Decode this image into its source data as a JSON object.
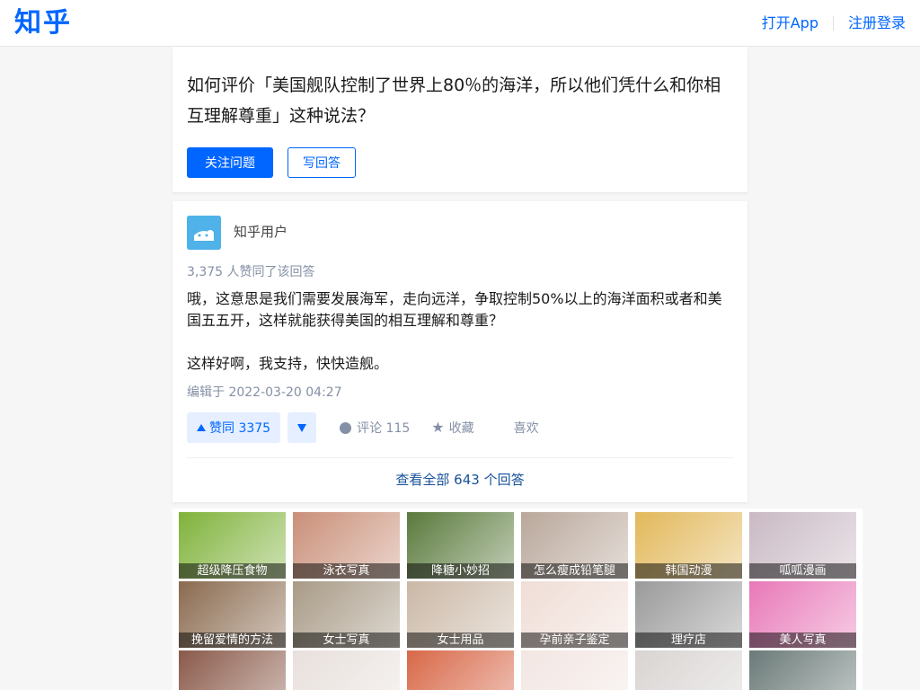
{
  "header": {
    "logo": "知乎",
    "open_app": "打开App",
    "register_login": "注册登录"
  },
  "question": {
    "title": "如何评价「美国舰队控制了世界上80％的海洋，所以他们凭什么和你相互理解尊重」这种说法？",
    "follow_label": "关注问题",
    "write_answer_label": "写回答"
  },
  "answer": {
    "author": "知乎用户",
    "votes_text": "3,375 人赞同了该回答",
    "paragraphs": [
      "哦，这意思是我们需要发展海军，走向远洋，争取控制50%以上的海洋面积或者和美国五五开，这样就能获得美国的相互理解和尊重？",
      "这样好啊，我支持，快快造舰。"
    ],
    "edited": "编辑于 2022-03-20 04:27",
    "vote_label": "赞同 3375",
    "comment_label": "评论 115",
    "collect_label": "收藏",
    "like_label": "喜欢",
    "view_all": "查看全部 643 个回答"
  },
  "ads": [
    {
      "caption": "超级降压食物",
      "color": "#7fb23a"
    },
    {
      "caption": "泳衣写真",
      "color": "#c98f78"
    },
    {
      "caption": "降糖小妙招",
      "color": "#5a7a3c"
    },
    {
      "caption": "怎么瘦成铅笔腿",
      "color": "#b9a79a"
    },
    {
      "caption": "韩国动漫",
      "color": "#e2b85a"
    },
    {
      "caption": "呱呱漫画",
      "color": "#c9b9c4"
    },
    {
      "caption": "挽留爱情的方法",
      "color": "#8a6a4e"
    },
    {
      "caption": "女士写真",
      "color": "#a89a86"
    },
    {
      "caption": "女士用品",
      "color": "#cbb8a6"
    },
    {
      "caption": "孕前亲子鉴定",
      "color": "#f0ddd6"
    },
    {
      "caption": "理疗店",
      "color": "#9a9a9a"
    },
    {
      "caption": "美人写真",
      "color": "#e878b8"
    },
    {
      "caption": "",
      "color": "#8a5a4a"
    },
    {
      "caption": "",
      "color": "#e8e0dc"
    },
    {
      "caption": "",
      "color": "#d86848"
    },
    {
      "caption": "",
      "color": "#f2e6e2"
    },
    {
      "caption": "",
      "color": "#d8d4d2"
    },
    {
      "caption": "",
      "color": "#6a7a78"
    }
  ]
}
